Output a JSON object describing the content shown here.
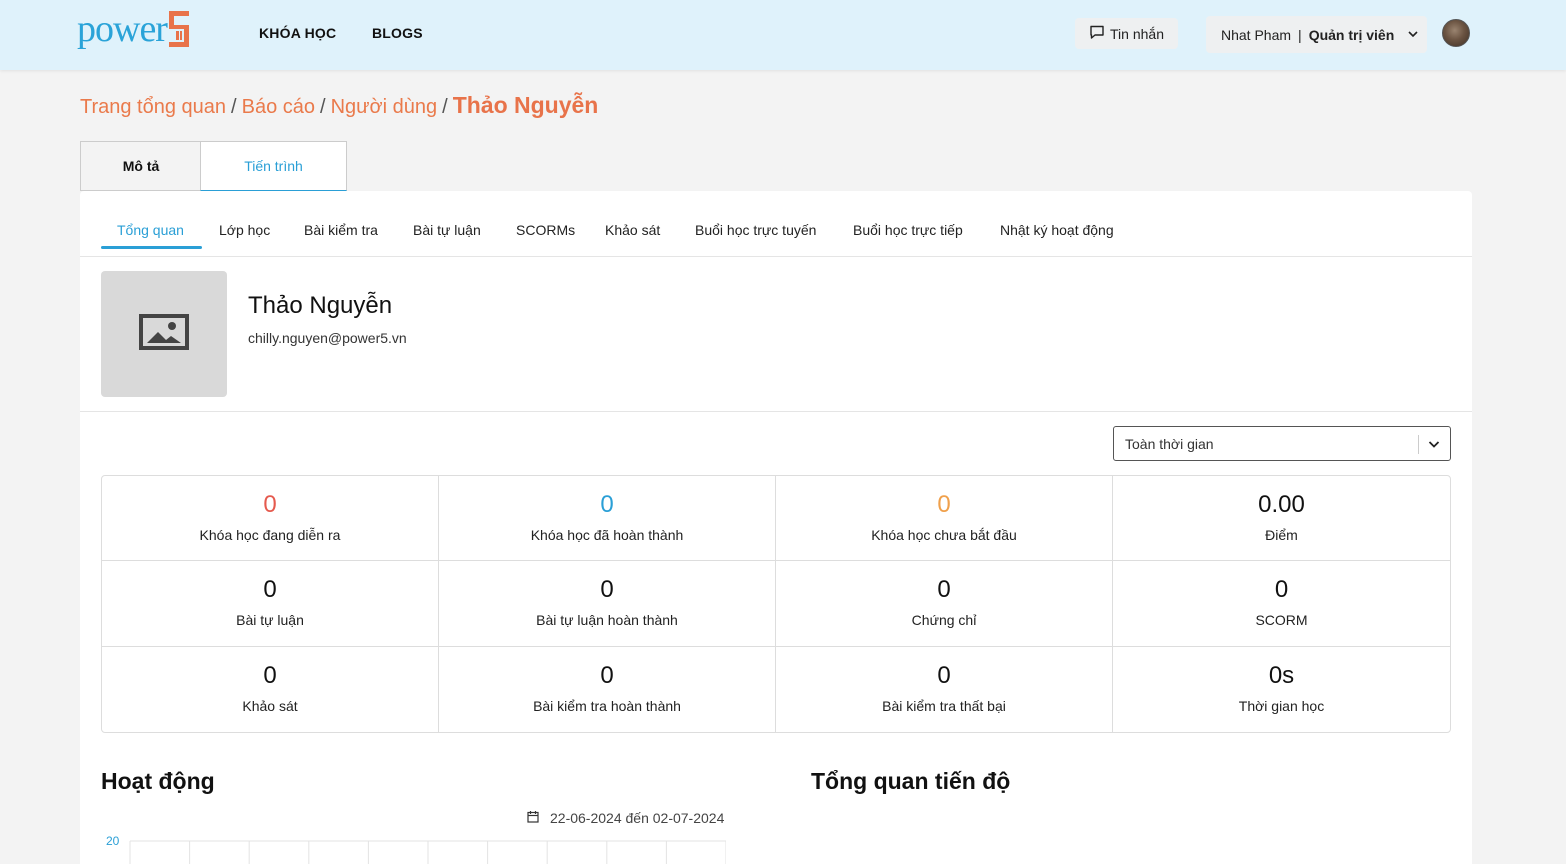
{
  "header": {
    "logo_text": "power",
    "nav": [
      "KHÓA HỌC",
      "BLOGS"
    ],
    "messages_label": "Tin nhắn",
    "user_name": "Nhat Pham",
    "user_separator": "|",
    "user_role": "Quản trị viên",
    "icons": [
      "chat-icon",
      "chevron-down-icon",
      "avatar"
    ]
  },
  "breadcrumb": {
    "items": [
      "Trang tổng quan",
      "Báo cáo",
      "Người dùng"
    ],
    "separator": "/",
    "current": "Thảo Nguyễn"
  },
  "top_tabs": {
    "description": "Mô tả",
    "progress": "Tiến trình",
    "active": "progress"
  },
  "sub_tabs": [
    "Tổng quan",
    "Lớp học",
    "Bài kiểm tra",
    "Bài tự luận",
    "SCORMs",
    "Khảo sát",
    "Buổi học trực tuyến",
    "Buổi học trực tiếp",
    "Nhật ký hoạt động"
  ],
  "profile": {
    "name": "Thảo Nguyễn",
    "email": "chilly.nguyen@power5.vn"
  },
  "filter": {
    "selected": "Toàn thời gian"
  },
  "stats": [
    {
      "value": "0",
      "label": "Khóa học đang diễn ra",
      "color": "#e55a4e"
    },
    {
      "value": "0",
      "label": "Khóa học đã hoàn thành",
      "color": "#2a9fd6"
    },
    {
      "value": "0",
      "label": "Khóa học chưa bắt đầu",
      "color": "#f0a04b"
    },
    {
      "value": "0.00",
      "label": "Điểm",
      "color": "#111111"
    },
    {
      "value": "0",
      "label": "Bài tự luận",
      "color": "#111111"
    },
    {
      "value": "0",
      "label": "Bài tự luận hoàn thành",
      "color": "#111111"
    },
    {
      "value": "0",
      "label": "Chứng chỉ",
      "color": "#111111"
    },
    {
      "value": "0",
      "label": "SCORM",
      "color": "#111111"
    },
    {
      "value": "0",
      "label": "Khảo sát",
      "color": "#111111"
    },
    {
      "value": "0",
      "label": "Bài kiểm tra hoàn thành",
      "color": "#111111"
    },
    {
      "value": "0",
      "label": "Bài kiểm tra thất bại",
      "color": "#111111"
    },
    {
      "value": "0s",
      "label": "Thời gian học",
      "color": "#111111"
    }
  ],
  "activity": {
    "title": "Hoạt động",
    "date_range": "22-06-2024 đến 02-07-2024",
    "y_max_label": "20"
  },
  "progress_overview": {
    "title": "Tổng quan tiến độ"
  },
  "colors": {
    "accent": "#2a9fd6",
    "brand_orange": "#e8734a",
    "header_bg": "#dff2fb"
  }
}
